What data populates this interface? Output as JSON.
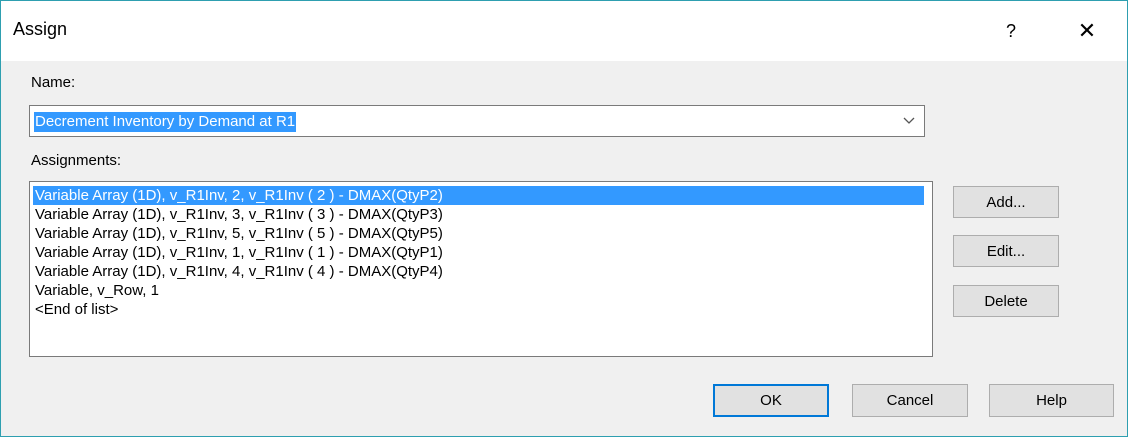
{
  "window": {
    "title": "Assign",
    "help_glyph": "?",
    "close_glyph": "✕"
  },
  "name_field": {
    "label": "Name:",
    "value": "Decrement Inventory by Demand at R1"
  },
  "assignments": {
    "label": "Assignments:",
    "items": [
      "Variable Array (1D), v_R1Inv, 2, v_R1Inv ( 2 )  - DMAX(QtyP2)",
      "Variable Array (1D), v_R1Inv, 3, v_R1Inv ( 3 )  - DMAX(QtyP3)",
      "Variable Array (1D), v_R1Inv, 5, v_R1Inv ( 5 )  - DMAX(QtyP5)",
      "Variable Array (1D), v_R1Inv, 1, v_R1Inv ( 1 )  - DMAX(QtyP1)",
      "Variable Array (1D), v_R1Inv, 4, v_R1Inv ( 4 )  - DMAX(QtyP4)",
      "Variable, v_Row, 1",
      "<End of list>"
    ],
    "selected_index": 0
  },
  "side_buttons": {
    "add": "Add...",
    "edit": "Edit...",
    "delete": "Delete"
  },
  "footer_buttons": {
    "ok": "OK",
    "cancel": "Cancel",
    "help": "Help"
  },
  "colors": {
    "selection": "#3399ff",
    "frame": "#2e9fb0",
    "default_button_border": "#0078d7"
  }
}
